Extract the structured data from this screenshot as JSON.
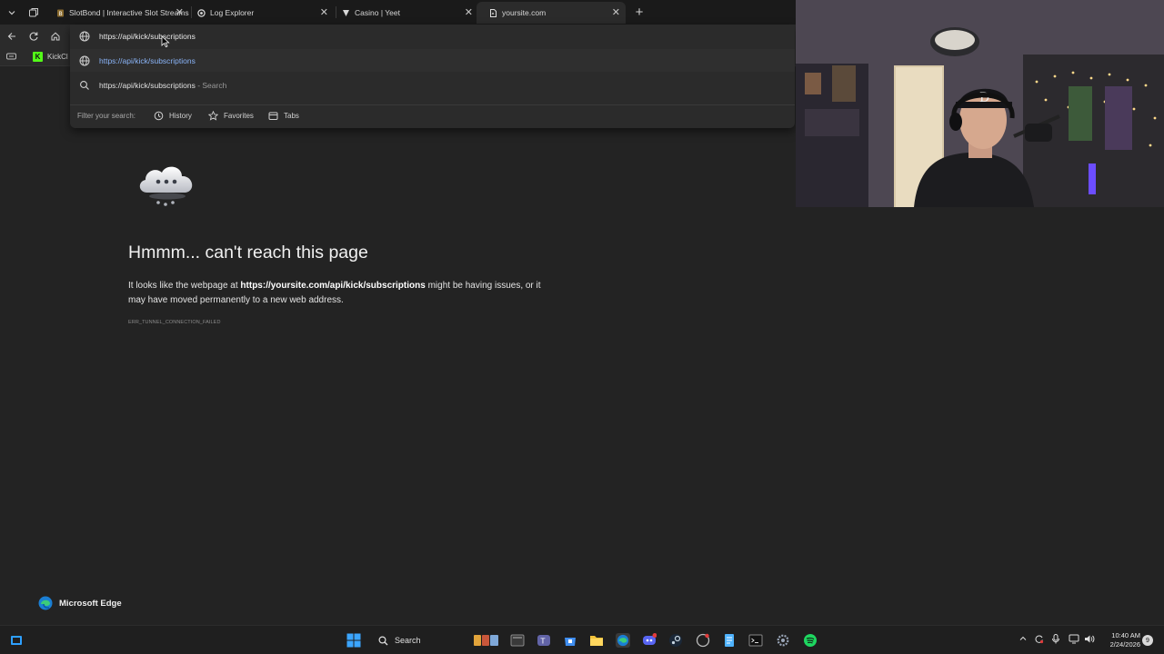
{
  "tabs": [
    {
      "label": "SlotBond | Interactive Slot Streams",
      "icon": "slot-icon"
    },
    {
      "label": "Log Explorer",
      "icon": "log-icon"
    },
    {
      "label": "Casino | Yeet",
      "icon": "yeet-icon"
    },
    {
      "label": "yoursite.com",
      "icon": "page-icon",
      "active": true
    }
  ],
  "favorites_bar": {
    "kick_label": "KickCl"
  },
  "omnibox": {
    "value": "https://api/kick/subscriptions",
    "suggestions": [
      {
        "text": "https://api/kick/subscriptions",
        "type": "url"
      },
      {
        "text": "https://api/kick/subscriptions",
        "suffix": " - Search",
        "type": "search"
      }
    ],
    "filter_label": "Filter your search:",
    "filters": [
      "History",
      "Favorites",
      "Tabs"
    ]
  },
  "error": {
    "title": "Hmmm... can't reach this page",
    "desc_prefix": "It looks like the webpage at ",
    "url": "https://yoursite.com/api/kick/subscriptions",
    "desc_suffix": " might be having issues, or it may have moved permanently to a new web address.",
    "code": "ERR_TUNNEL_CONNECTION_FAILED"
  },
  "brand": {
    "name": "Microsoft Edge"
  },
  "taskbar": {
    "search_label": "Search",
    "time": "10:40 AM",
    "date": "2/24/2026",
    "notifications": "9"
  },
  "colors": {
    "accent": "#8ab4f8",
    "kick": "#53fc18",
    "background": "#232323"
  }
}
